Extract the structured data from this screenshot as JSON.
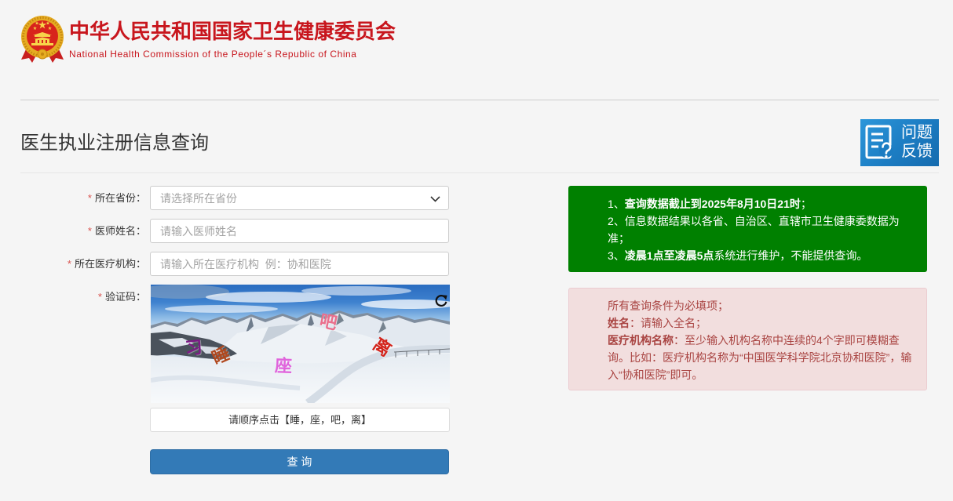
{
  "colors": {
    "brand_red": "#c8161d",
    "accent": "#337ab7",
    "notice_green": "#008000",
    "notice_danger_bg": "#f2dede",
    "notice_danger_text": "#a94442",
    "required_red": "#d9534f"
  },
  "header": {
    "emblem_icon": "national-emblem-icon",
    "title_cn": "中华人民共和国国家卫生健康委员会",
    "title_en": "National Health Commission of the People´s Republic of China"
  },
  "page": {
    "title": "医生执业注册信息查询"
  },
  "feedback": {
    "icon": "feedback-document-icon",
    "label_line1": "问题",
    "label_line2": "反馈"
  },
  "form": {
    "required_mark": "*",
    "province": {
      "label": "所在省份：",
      "value": "",
      "placeholder": "请选择所在省份",
      "icon": "chevron-down-icon"
    },
    "doctor_name": {
      "label": "医师姓名：",
      "value": "",
      "placeholder": "请输入医师姓名"
    },
    "institution": {
      "label": "所在医疗机构：",
      "value": "",
      "placeholder": "请输入所在医疗机构  例：协和医院"
    },
    "captcha": {
      "label": "验证码：",
      "chars": [
        "习",
        "睡",
        "座",
        "吧",
        "离"
      ],
      "instruction": "请顺序点击【睡，座，吧，离】",
      "refresh_icon": "refresh-icon"
    },
    "submit_label": "查 询"
  },
  "notices": {
    "info": {
      "line1": {
        "prefix": "1、",
        "bold": "查询数据截止到2025年8月10日21时",
        "suffix": "；"
      },
      "line2": {
        "text": "2、信息数据结果以各省、自治区、直辖市卫生健康委数据为准；"
      },
      "line3": {
        "prefix": "3、",
        "bold": "凌晨1点至凌晨5点",
        "suffix": "系统进行维护，不能提供查询。"
      }
    },
    "requirements": {
      "line1": {
        "text": "所有查询条件为必填项；"
      },
      "line2": {
        "bold": "姓名",
        "suffix": "：请输入全名；"
      },
      "line3": {
        "bold": "医疗机构名称",
        "suffix": "：至少输入机构名称中连续的4个字即可模糊查询。比如：医疗机构名称为“中国医学科学院北京协和医院”，输入“协和医院”即可。"
      }
    }
  }
}
